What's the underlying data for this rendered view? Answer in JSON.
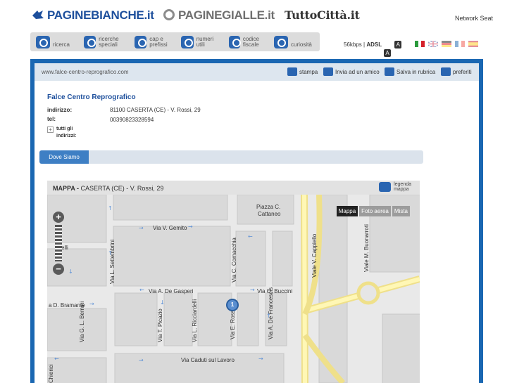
{
  "brands": {
    "paginebianche": "PAGINEBIANCHE.it",
    "paginegialle": "PAGINEGIALLE.it",
    "tuttocitta": "TuttoCittà.it",
    "network": "Network Seat"
  },
  "nav": {
    "items": [
      {
        "label": "ricerca",
        "icon": "search-icon"
      },
      {
        "label": "ricerche speciali",
        "icon": "puzzle-icon"
      },
      {
        "label": "cap e prefissi",
        "icon": "globe-icon"
      },
      {
        "label": "numeri utili",
        "icon": "phone-icon"
      },
      {
        "label": "codice fiscale",
        "icon": "id-card-icon"
      },
      {
        "label": "curiosità",
        "icon": "spiral-icon"
      }
    ],
    "speed": "56kbps",
    "adsl": "ADSL",
    "font_a_small": "A",
    "font_a_large": "A",
    "flags": [
      "italian-flag",
      "english-flag",
      "german-flag",
      "french-flag",
      "spanish-flag"
    ]
  },
  "url": "www.falce-centro-reprografico.com",
  "actions": {
    "stampa": "stampa",
    "invia": "Invia ad un amico",
    "salva": "Salva in rubrica",
    "preferiti": "preferiti"
  },
  "business": {
    "name": "Falce Centro Reprografico",
    "address_label": "indirizzo:",
    "address": "81100 CASERTA (CE) - V. Rossi, 29",
    "phone_label": "tel:",
    "phone": "00390823328594",
    "all_addresses_line1": "tutti gli",
    "all_addresses_line2": "indirizzi:"
  },
  "tabs": {
    "dove_siamo": "Dove Siamo"
  },
  "map": {
    "title": "MAPPA -",
    "location": "CASERTA (CE) - V. Rossi, 29",
    "legend_line1": "legenda",
    "legend_line2": "mappa",
    "buttons": [
      "Mappa",
      "Foto aerea",
      "Mista"
    ],
    "marker_number": "1",
    "zoom_plus": "+",
    "zoom_minus": "−",
    "streets": {
      "gemito": "Via V. Gemito",
      "piazza1": "Piazza C.",
      "piazza2": "Cattaneo",
      "cappiello": "Viale V. Cappiello",
      "buonarroti": "Viale M. Buonarroti",
      "settembrini": "Via L. Settembrini",
      "comacchia": "Via C. Comacchia",
      "gasperi": "Via A. De Gasperi",
      "buccini": "Via O. Buccini",
      "bramante": "a D. Bramante",
      "bernini": "Via G. L. Bernini",
      "picazio": "Via T. Picazio",
      "ricciardelli": "Via L. Ricciardelli",
      "rossi": "Via E. Rossi",
      "francescis": "Via A. De Francescis",
      "caduti": "Via Caduti sul Lavoro",
      "ticelli": "ticelli",
      "chierici": "Chierici"
    }
  }
}
